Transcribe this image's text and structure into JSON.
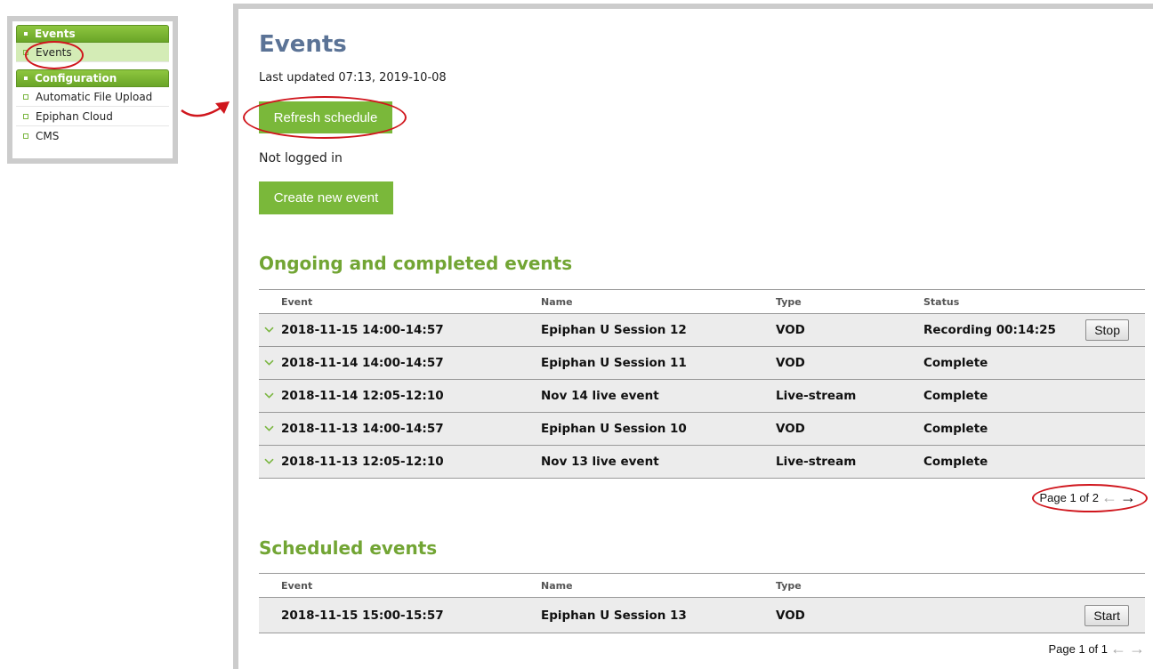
{
  "sidebar": {
    "groups": [
      {
        "header": "Events",
        "items": [
          {
            "label": "Events",
            "active": true
          }
        ]
      },
      {
        "header": "Configuration",
        "items": [
          {
            "label": "Automatic File Upload"
          },
          {
            "label": "Epiphan Cloud"
          },
          {
            "label": "CMS"
          }
        ]
      }
    ]
  },
  "main": {
    "title": "Events",
    "last_updated": "Last updated 07:13, 2019-10-08",
    "refresh_label": "Refresh schedule",
    "login_status": "Not logged in",
    "create_label": "Create new event"
  },
  "ongoing": {
    "title": "Ongoing and completed events",
    "columns": [
      "Event",
      "Name",
      "Type",
      "Status"
    ],
    "rows": [
      {
        "event": "2018-11-15 14:00-14:57",
        "name": "Epiphan U Session 12",
        "type": "VOD",
        "status": "Recording 00:14:25",
        "action": "Stop"
      },
      {
        "event": "2018-11-14 14:00-14:57",
        "name": "Epiphan U Session 11",
        "type": "VOD",
        "status": "Complete"
      },
      {
        "event": "2018-11-14 12:05-12:10",
        "name": "Nov 14 live event",
        "type": "Live-stream",
        "status": "Complete"
      },
      {
        "event": "2018-11-13 14:00-14:57",
        "name": "Epiphan U Session 10",
        "type": "VOD",
        "status": "Complete"
      },
      {
        "event": "2018-11-13 12:05-12:10",
        "name": "Nov 13 live event",
        "type": "Live-stream",
        "status": "Complete"
      }
    ],
    "pager": "Page 1 of 2"
  },
  "scheduled": {
    "title": "Scheduled events",
    "columns": [
      "Event",
      "Name",
      "Type"
    ],
    "rows": [
      {
        "event": "2018-11-15 15:00-15:57",
        "name": "Epiphan U Session 13",
        "type": "VOD",
        "action": "Start"
      }
    ],
    "pager": "Page 1 of 1"
  },
  "colors": {
    "accent_green": "#7ab83a",
    "title_blue": "#5b7396",
    "section_green": "#72a534",
    "annotation_red": "#d0161d"
  },
  "icons": {
    "expand": "chevron-down-icon",
    "prev": "arrow-left-icon",
    "next": "arrow-right-icon"
  }
}
